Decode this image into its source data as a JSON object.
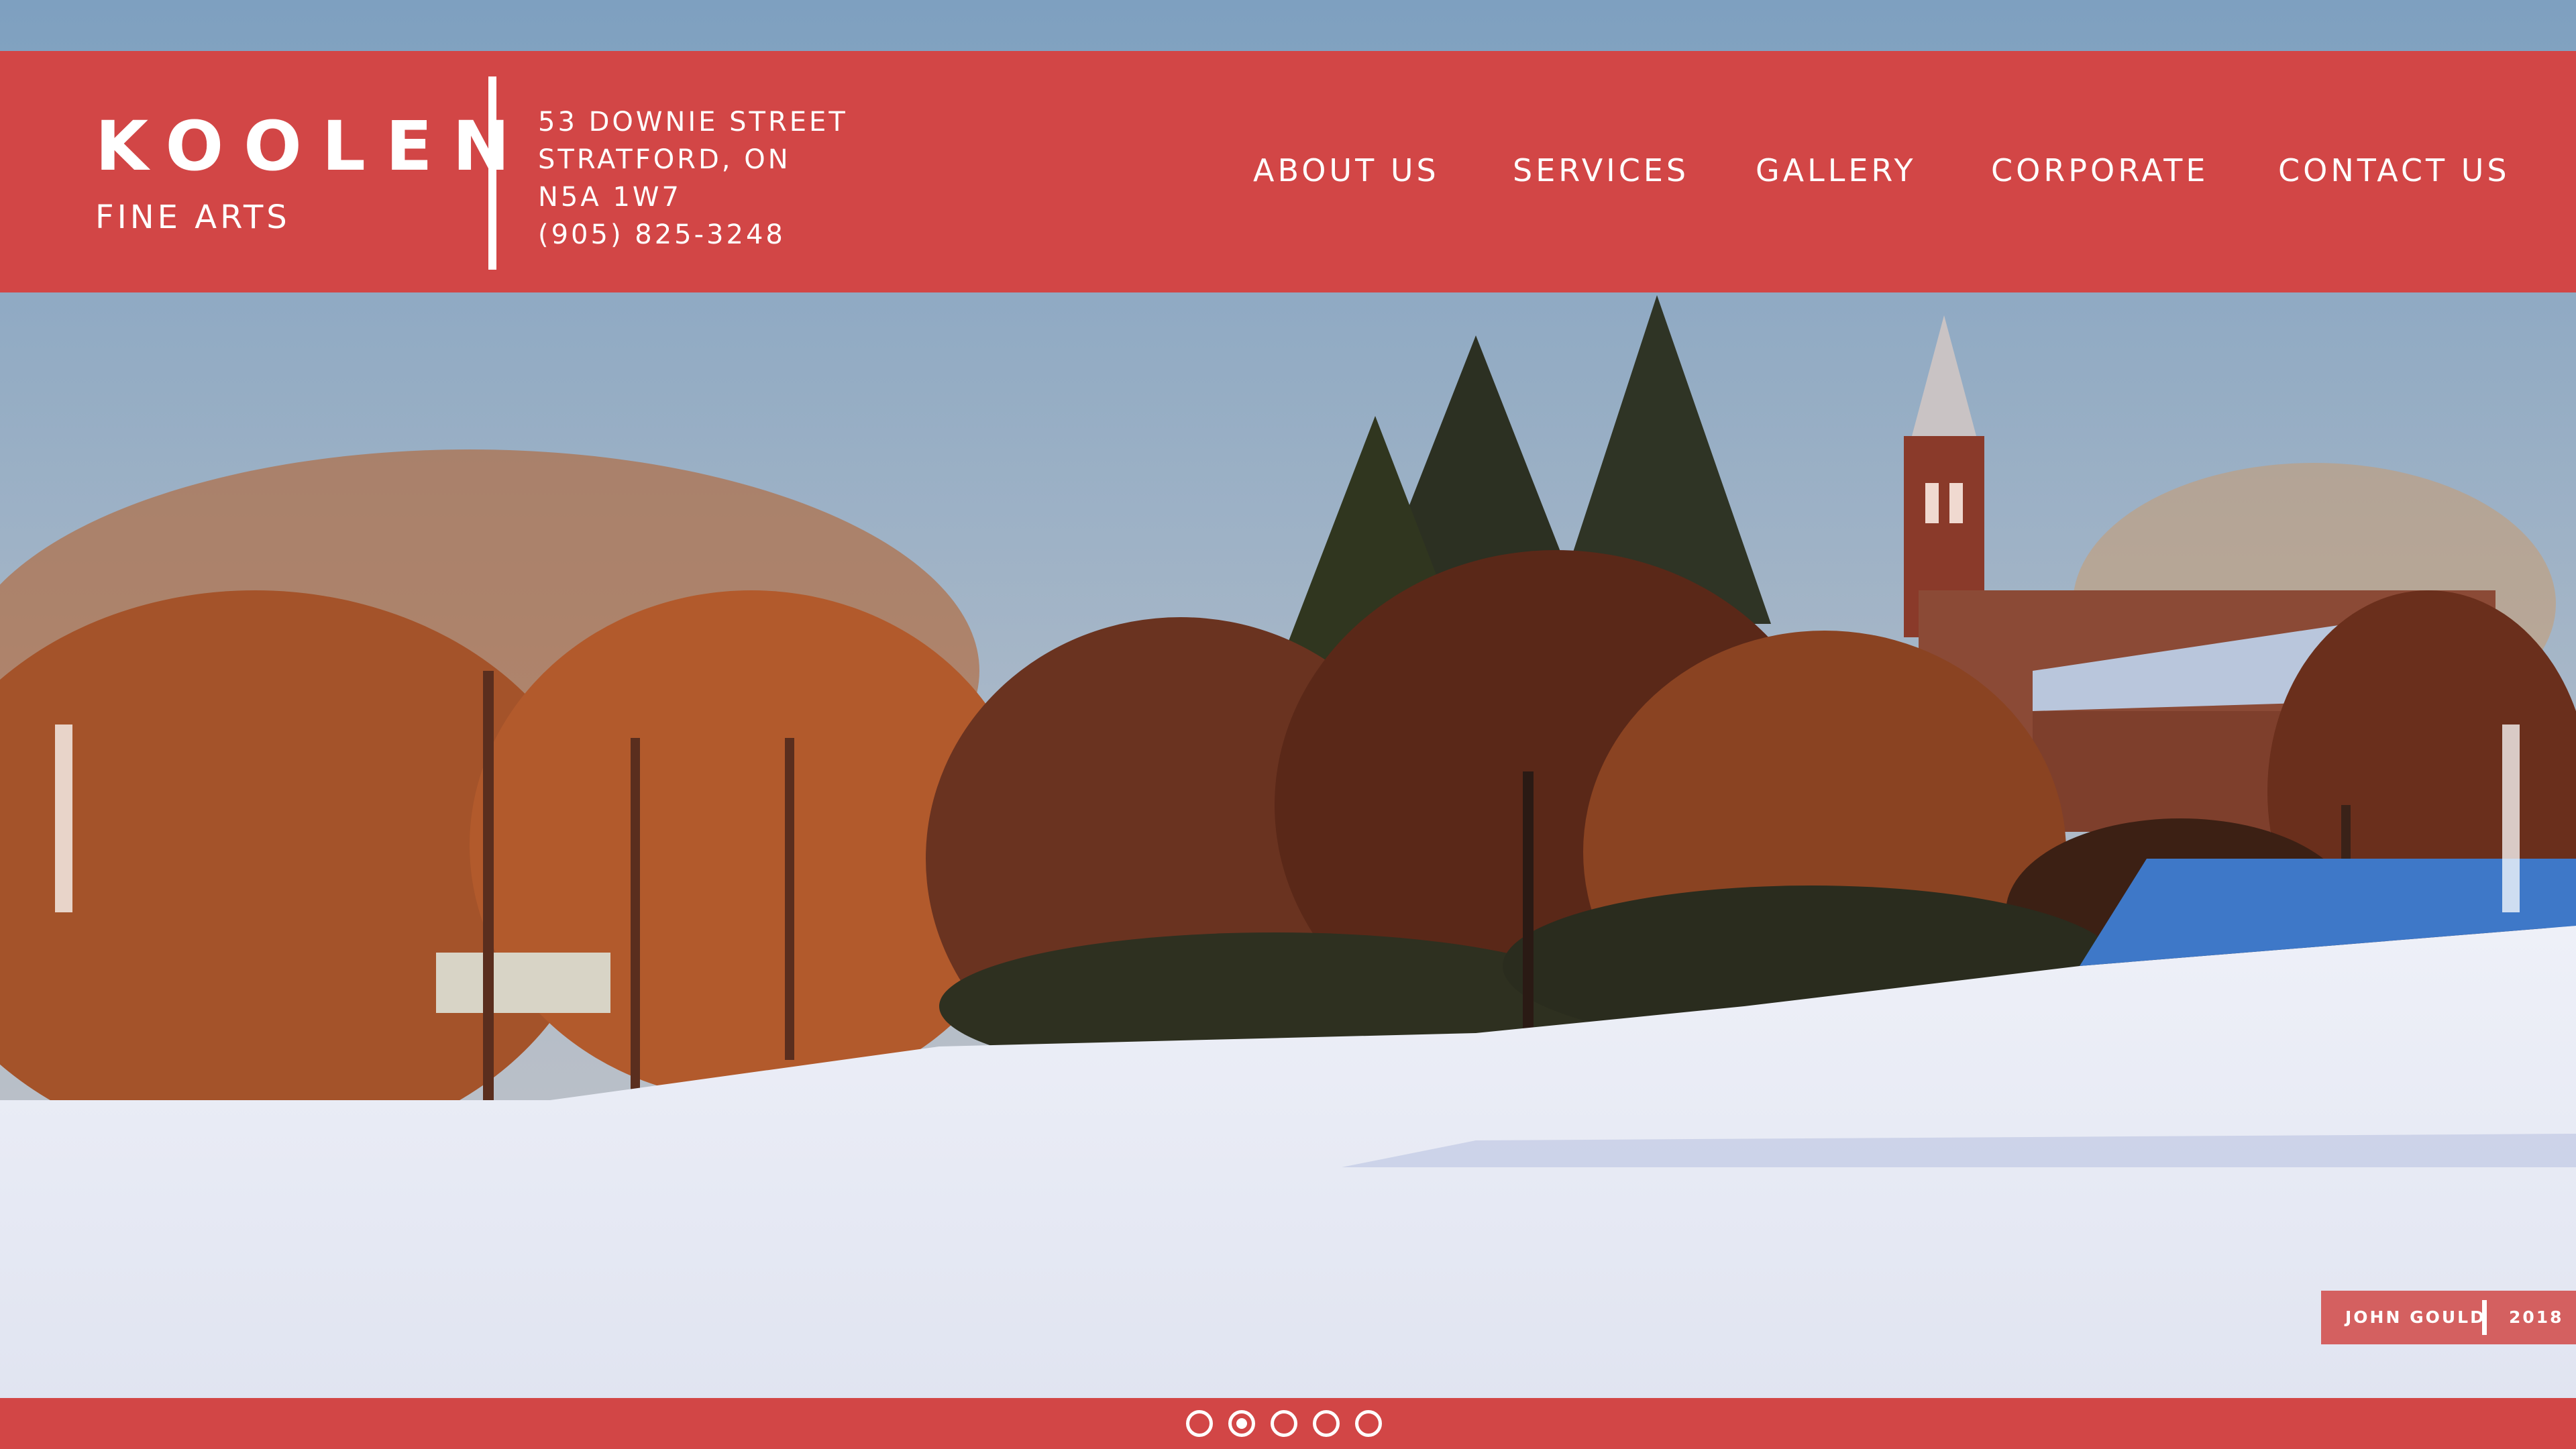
{
  "brand": {
    "name": "KOOLEN",
    "subtitle": "FINE ARTS"
  },
  "address": {
    "line1": "53 DOWNIE STREET",
    "line2": "STRATFORD, ON",
    "line3": "N5A 1W7",
    "phone": "(905) 825-3248"
  },
  "nav": {
    "about": "ABOUT US",
    "services": "SERVICES",
    "gallery": "GALLERY",
    "corporate": "CORPORATE",
    "contact": "CONTACT US"
  },
  "slider": {
    "caption_artist": "JOHN GOULD",
    "caption_year": "2018",
    "slide_count": 5,
    "active_slide": 2
  },
  "colors": {
    "brand_red": "#d24646",
    "caption_red": "#d46060",
    "text": "#ffffff"
  }
}
